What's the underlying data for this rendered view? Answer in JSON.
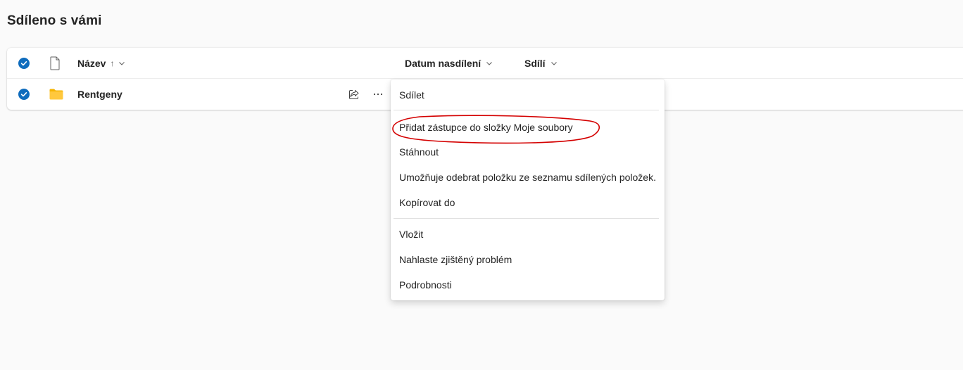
{
  "page": {
    "title": "Sdíleno s vámi"
  },
  "colors": {
    "accent": "#0f6cbd",
    "folder": "#ffc83d",
    "folder_dark": "#f5b400",
    "annotation": "#d40000"
  },
  "header": {
    "name_label": "Název",
    "sort_indicator": "↑",
    "date_label": "Datum nasdílení",
    "shared_by_label": "Sdílí"
  },
  "items": [
    {
      "name": "Rentgeny",
      "type": "folder"
    }
  ],
  "menu": {
    "items": [
      {
        "label": "Sdílet"
      },
      {
        "label": "Přidat zástupce do složky Moje soubory"
      },
      {
        "label": "Stáhnout"
      },
      {
        "label": "Umožňuje odebrat položku ze seznamu sdílených položek."
      },
      {
        "label": "Kopírovat do"
      },
      {
        "label": "Vložit"
      },
      {
        "label": "Nahlaste zjištěný problém"
      },
      {
        "label": "Podrobnosti"
      }
    ]
  },
  "icons": {
    "check": "checkmark-circle-icon",
    "file": "document-icon",
    "folder": "folder-icon",
    "share": "share-icon",
    "more": "more-icon",
    "chevron": "chevron-down-icon"
  }
}
